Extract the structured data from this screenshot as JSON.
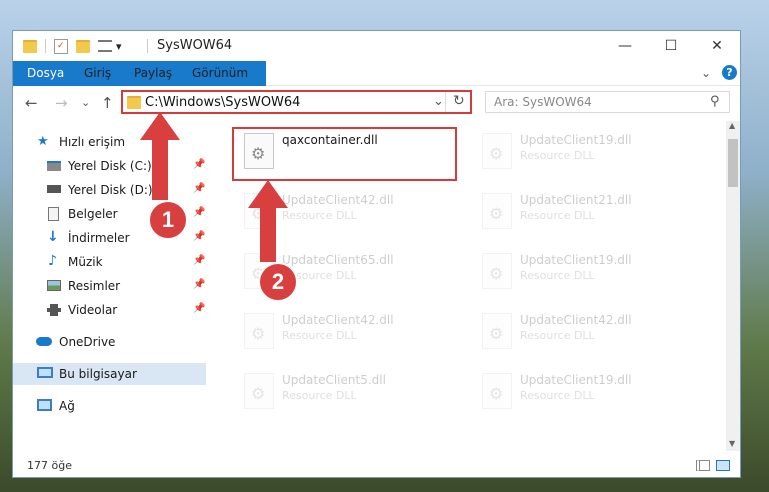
{
  "window": {
    "title": "SysWOW64",
    "minimize_symbol": "—",
    "maximize_symbol": "☐",
    "close_symbol": "✕"
  },
  "quick_access_toolbar": {
    "dropdown_symbol": "▾"
  },
  "ribbon": {
    "tabs": [
      {
        "label": "Dosya"
      },
      {
        "label": "Giriş"
      },
      {
        "label": "Paylaş"
      },
      {
        "label": "Görünüm"
      }
    ],
    "collapse_symbol": "⌄",
    "help_symbol": "?"
  },
  "address_bar": {
    "back_symbol": "←",
    "forward_symbol": "→",
    "recent_symbol": "⌄",
    "up_symbol": "↑",
    "path": "C:\\Windows\\SysWOW64",
    "dropdown_symbol": "⌄",
    "refresh_symbol": "↻"
  },
  "search": {
    "placeholder": "Ara: SysWOW64",
    "icon_symbol": "⚲"
  },
  "nav_pane": {
    "items": [
      {
        "label": "Hızlı erişim",
        "icon": "star-icon",
        "pinned": false
      },
      {
        "label": "Yerel Disk (C:)",
        "icon": "drive-icon",
        "pinned": true
      },
      {
        "label": "Yerel Disk (D:)",
        "icon": "drive-icon",
        "pinned": true
      },
      {
        "label": "Belgeler",
        "icon": "documents-icon",
        "pinned": true
      },
      {
        "label": "İndirmeler",
        "icon": "download-icon",
        "pinned": true
      },
      {
        "label": "Müzik",
        "icon": "music-icon",
        "pinned": true
      },
      {
        "label": "Resimler",
        "icon": "pictures-icon",
        "pinned": true
      },
      {
        "label": "Videolar",
        "icon": "videos-icon",
        "pinned": true
      },
      {
        "label": "OneDrive",
        "icon": "cloud-icon",
        "pinned": false
      },
      {
        "label": "Bu bilgisayar",
        "icon": "computer-icon",
        "pinned": false,
        "selected": true
      },
      {
        "label": "Ağ",
        "icon": "network-icon",
        "pinned": false
      }
    ],
    "pin_symbol": "📌"
  },
  "files": [
    {
      "name": "qaxcontainer.dll",
      "type": "",
      "highlighted": true
    },
    {
      "name": "UpdateClient19.dll",
      "type": "Resource DLL"
    },
    {
      "name": "UpdateClient42.dll",
      "type": "Resource DLL"
    },
    {
      "name": "UpdateClient21.dll",
      "type": "Resource DLL"
    },
    {
      "name": "UpdateClient65.dll",
      "type": "Resource DLL"
    },
    {
      "name": "UpdateClient19.dll",
      "type": "Resource DLL"
    },
    {
      "name": "UpdateClient42.dll",
      "type": "Resource DLL"
    },
    {
      "name": "UpdateClient42.dll",
      "type": "Resource DLL"
    },
    {
      "name": "UpdateClient5.dll",
      "type": "Resource DLL"
    },
    {
      "name": "UpdateClient19.dll",
      "type": "Resource DLL"
    }
  ],
  "status_bar": {
    "item_count": "177 öğe"
  },
  "callouts": {
    "step1": "1",
    "step2": "2"
  },
  "colors": {
    "accent": "#1979ca",
    "highlight": "#d43c3c"
  }
}
